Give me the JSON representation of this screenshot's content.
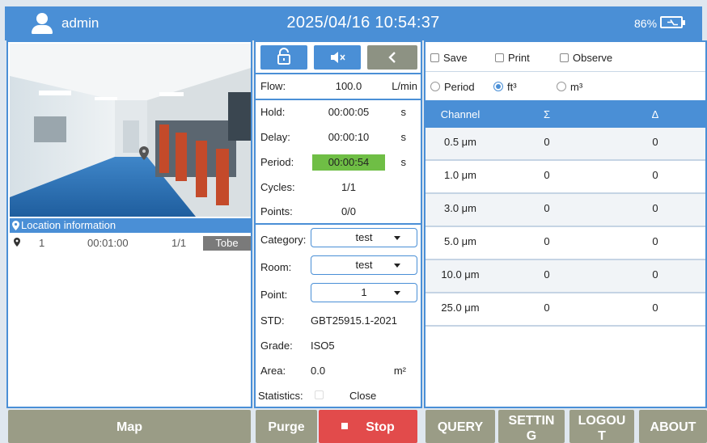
{
  "header": {
    "username": "admin",
    "datetime": "2025/04/16 10:54:37",
    "battery": "86%"
  },
  "location": {
    "header": "Location information",
    "rows": [
      {
        "index": "1",
        "time": "00:01:00",
        "progress": "1/1",
        "status": "Tobe"
      }
    ]
  },
  "controls": {
    "flow": {
      "label": "Flow:",
      "value": "100.0",
      "unit": "L/min"
    },
    "hold": {
      "label": "Hold:",
      "value": "00:00:05",
      "unit": "s"
    },
    "delay": {
      "label": "Delay:",
      "value": "00:00:10",
      "unit": "s"
    },
    "period": {
      "label": "Period:",
      "value": "00:00:54",
      "unit": "s"
    },
    "cycles": {
      "label": "Cycles:",
      "value": "1/1"
    },
    "points": {
      "label": "Points:",
      "value": "0/0"
    },
    "category": {
      "label": "Category:",
      "value": "test"
    },
    "room": {
      "label": "Room:",
      "value": "test"
    },
    "point": {
      "label": "Point:",
      "value": "1"
    },
    "std": {
      "label": "STD:",
      "value": "GBT25915.1-2021"
    },
    "grade": {
      "label": "Grade:",
      "value": "ISO5"
    },
    "area": {
      "label": "Area:",
      "value": "0.0",
      "unit": "m²"
    },
    "statistics": {
      "label": "Statistics:",
      "action": "Close"
    }
  },
  "options": {
    "save": "Save",
    "print": "Print",
    "observe": "Observe",
    "mode_period": "Period",
    "mode_ft3": "ft³",
    "mode_m3": "m³"
  },
  "table": {
    "headers": [
      "Channel",
      "Σ",
      "Δ"
    ],
    "rows": [
      [
        "0.5 μm",
        "0",
        "0"
      ],
      [
        "1.0 μm",
        "0",
        "0"
      ],
      [
        "3.0 μm",
        "0",
        "0"
      ],
      [
        "5.0 μm",
        "0",
        "0"
      ],
      [
        "10.0 μm",
        "0",
        "0"
      ],
      [
        "25.0 μm",
        "0",
        "0"
      ]
    ]
  },
  "buttons": {
    "map": "Map",
    "purge": "Purge",
    "stop": "Stop",
    "query": "QUERY",
    "setting_line1": "SETTIN",
    "setting_line2": "G",
    "logout_line1": "LOGOU",
    "logout_line2": "T",
    "about": "ABOUT"
  },
  "colors": {
    "accent": "#4a8fd6",
    "period_highlight": "#6fbe45",
    "stop": "#e24b4b",
    "button_gray": "#9a9c86"
  }
}
